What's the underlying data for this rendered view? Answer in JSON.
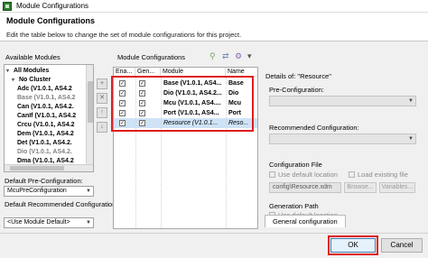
{
  "window": {
    "title": "Module Configurations"
  },
  "header": {
    "title": "Module Configurations",
    "description": "Edit the table below to change the set of module configurations for this project."
  },
  "left": {
    "available_label": "Available Modules",
    "tree": [
      {
        "label": "All Modules",
        "style": "bold",
        "arrow": "expanded",
        "indent": 0
      },
      {
        "label": "No Cluster",
        "style": "bold",
        "arrow": "expanded",
        "indent": 1
      },
      {
        "label": "Adc (V1.0.1, AS4.2",
        "style": "bold",
        "indent": 2
      },
      {
        "label": "Base (V1.0.1, AS4.2",
        "style": "gray",
        "indent": 2
      },
      {
        "label": "Can (V1.0.1, AS4.2.",
        "style": "bold",
        "indent": 2
      },
      {
        "label": "CanIf (V1.0.1, AS4.2",
        "style": "bold",
        "indent": 2
      },
      {
        "label": "Crcu (V1.0.1, AS4.2",
        "style": "bold",
        "indent": 2
      },
      {
        "label": "Dem (V1.0.1, AS4.2",
        "style": "bold",
        "indent": 2
      },
      {
        "label": "Det (V1.0.1, AS4.2.",
        "style": "bold",
        "indent": 2
      },
      {
        "label": "Dio (V1.0.1, AS4.2.",
        "style": "gray",
        "indent": 2
      },
      {
        "label": "Dma (V1.0.1, AS4.2",
        "style": "bold",
        "indent": 2
      }
    ],
    "default_pre_label": "Default Pre-Configuration:",
    "default_pre_value": "McuPreConfiguration",
    "default_rec_label": "Default Recommended Configuration:",
    "default_rec_value": "<Use Module Default>"
  },
  "side_buttons": [
    "+",
    "✕",
    "↑",
    "↓"
  ],
  "table": {
    "title": "Module Configurations",
    "columns": [
      "Ena...",
      "Gen...",
      "Module",
      "Name"
    ],
    "rows": [
      {
        "enabled": "✓",
        "generate": "✓",
        "module": "Base (V1.0.1, AS4...",
        "name": "Base",
        "selected": false
      },
      {
        "enabled": "✓",
        "generate": "✓",
        "module": "Dio (V1.0.1, AS4.2...",
        "name": "Dio",
        "selected": false
      },
      {
        "enabled": "✓",
        "generate": "✓",
        "module": "Mcu (V1.0.1, AS4....",
        "name": "Mcu",
        "selected": false
      },
      {
        "enabled": "✓",
        "generate": "✓",
        "module": "Port (V1.0.1, AS4...",
        "name": "Port",
        "selected": false
      },
      {
        "enabled": "✓",
        "generate": "✓",
        "module": "Resource (V1.0.1...",
        "name": "Reso...",
        "selected": true
      }
    ]
  },
  "details": {
    "title": "Details of: \"Resource\"",
    "pre_config_label": "Pre-Configuration:",
    "rec_config_label": "Recommended Configuration:",
    "config_file_label": "Configuration File",
    "use_default_label": "Use default location",
    "load_existing_label": "Load existing file",
    "file_path": "config\\Resource.xdm",
    "browse_label": "Browse...",
    "variables_label": "Variables...",
    "generation_path_label": "Generation Path",
    "general_tab": "General configuration"
  },
  "footer": {
    "ok_label": "OK",
    "cancel_label": "Cancel"
  }
}
